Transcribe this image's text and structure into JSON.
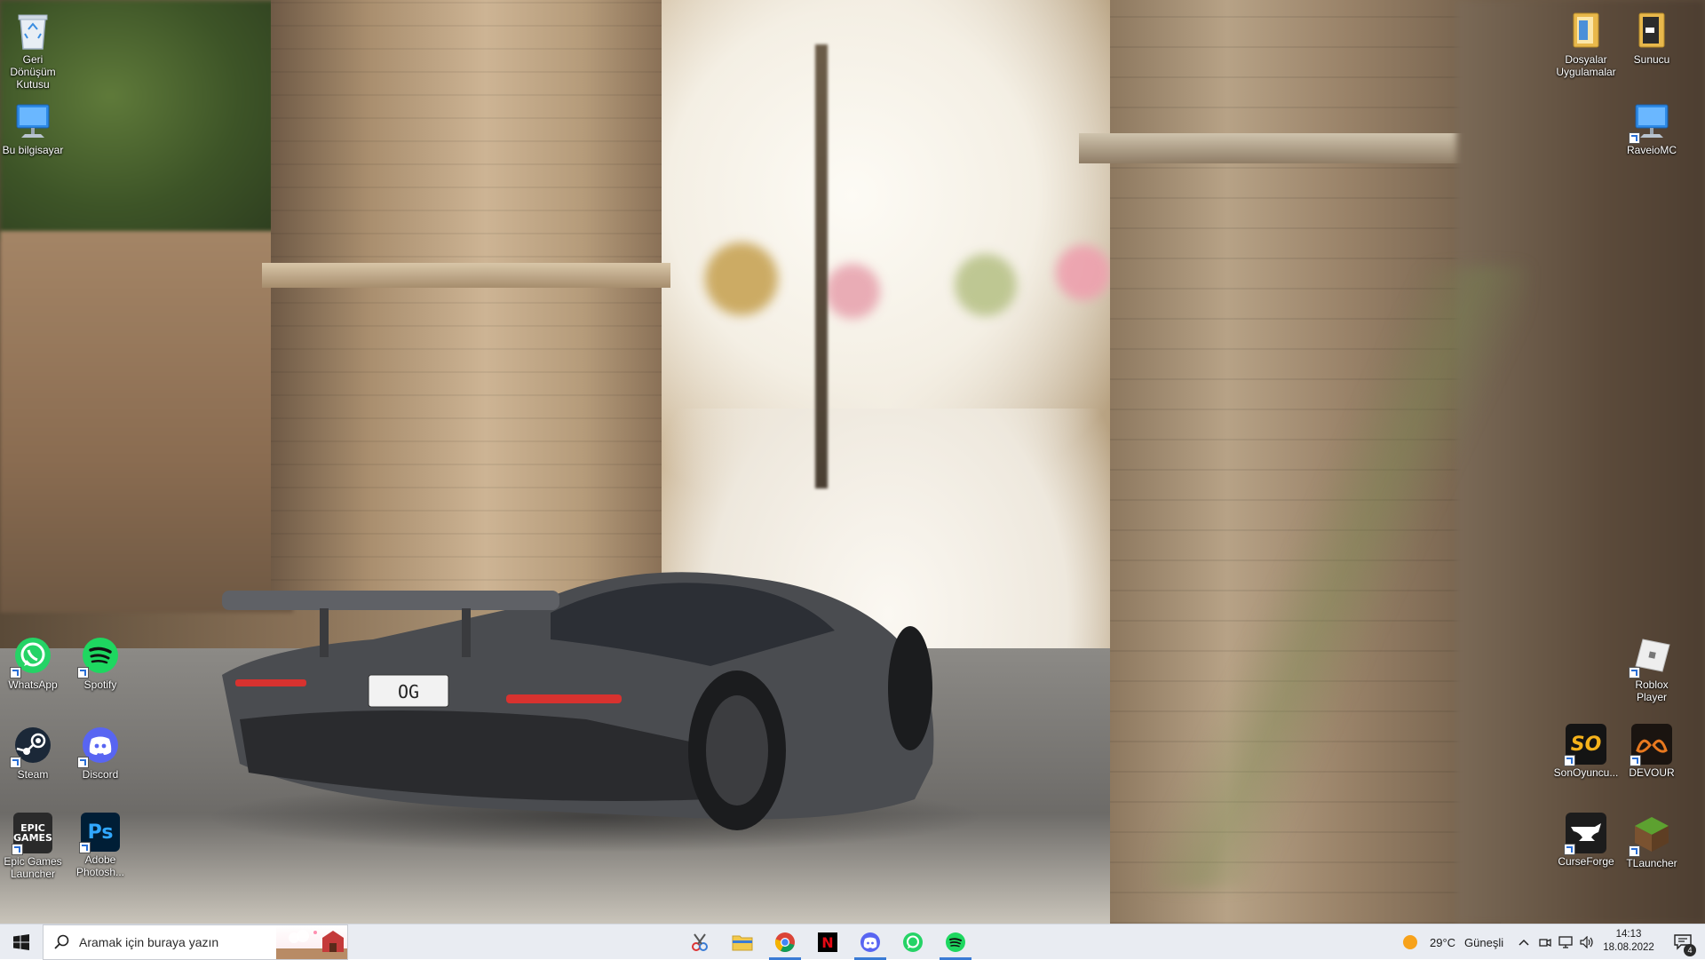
{
  "desktop": {
    "left_icons": [
      {
        "label": "Geri\nDönüşüm\nKutusu",
        "icon": "recycle-bin-icon"
      },
      {
        "label": "Bu bilgisayar",
        "icon": "this-pc-icon"
      }
    ],
    "right_top_icons": [
      {
        "label": "Dosyalar\nUygulamalar",
        "icon": "folder-files-icon"
      },
      {
        "label": "Sunucu",
        "icon": "folder-server-icon"
      },
      {
        "label": "RaveioMC",
        "icon": "computer-shortcut-icon"
      }
    ],
    "left_bottom_icons": [
      {
        "label": "WhatsApp",
        "icon": "whatsapp-icon"
      },
      {
        "label": "Spotify",
        "icon": "spotify-icon"
      },
      {
        "label": "Steam",
        "icon": "steam-icon"
      },
      {
        "label": "Discord",
        "icon": "discord-icon"
      },
      {
        "label": "Epic Games\nLauncher",
        "icon": "epic-games-icon",
        "glyph": "EPIC\nGAMES"
      },
      {
        "label": "Adobe\nPhotosh...",
        "icon": "photoshop-icon",
        "glyph": "Ps"
      }
    ],
    "right_bottom_icons": [
      {
        "label": "Roblox Player",
        "icon": "roblox-icon"
      },
      {
        "label": "SonOyuncu...",
        "icon": "sonoyuncu-icon",
        "glyph": "SO"
      },
      {
        "label": "DEVOUR",
        "icon": "devour-icon"
      },
      {
        "label": "CurseForge",
        "icon": "curseforge-icon"
      },
      {
        "label": "TLauncher",
        "icon": "tlauncher-icon"
      }
    ],
    "wallpaper": {
      "plate_text": "OG"
    }
  },
  "taskbar": {
    "search_placeholder": "Aramak için buraya yazın",
    "pinned_apps": [
      {
        "name": "Snipping Tool",
        "icon": "snipping-tool-icon",
        "active": false
      },
      {
        "name": "File Explorer",
        "icon": "file-explorer-icon",
        "active": false
      },
      {
        "name": "Google Chrome",
        "icon": "chrome-icon",
        "active": true
      },
      {
        "name": "Netflix",
        "icon": "netflix-icon",
        "active": false,
        "glyph": "N"
      },
      {
        "name": "Discord",
        "icon": "discord-icon",
        "active": true
      },
      {
        "name": "WhatsApp",
        "icon": "whatsapp-icon",
        "active": false
      },
      {
        "name": "Spotify",
        "icon": "spotify-icon",
        "active": true
      }
    ],
    "weather": {
      "temp": "29°C",
      "condition": "Güneşli",
      "icon": "sun-icon"
    },
    "clock": {
      "time": "14:13",
      "date": "18.08.2022"
    },
    "notifications": {
      "count": "4"
    },
    "colors": {
      "accent": "#3a7bd5",
      "taskbar_bg": "#e9ecf2"
    }
  }
}
